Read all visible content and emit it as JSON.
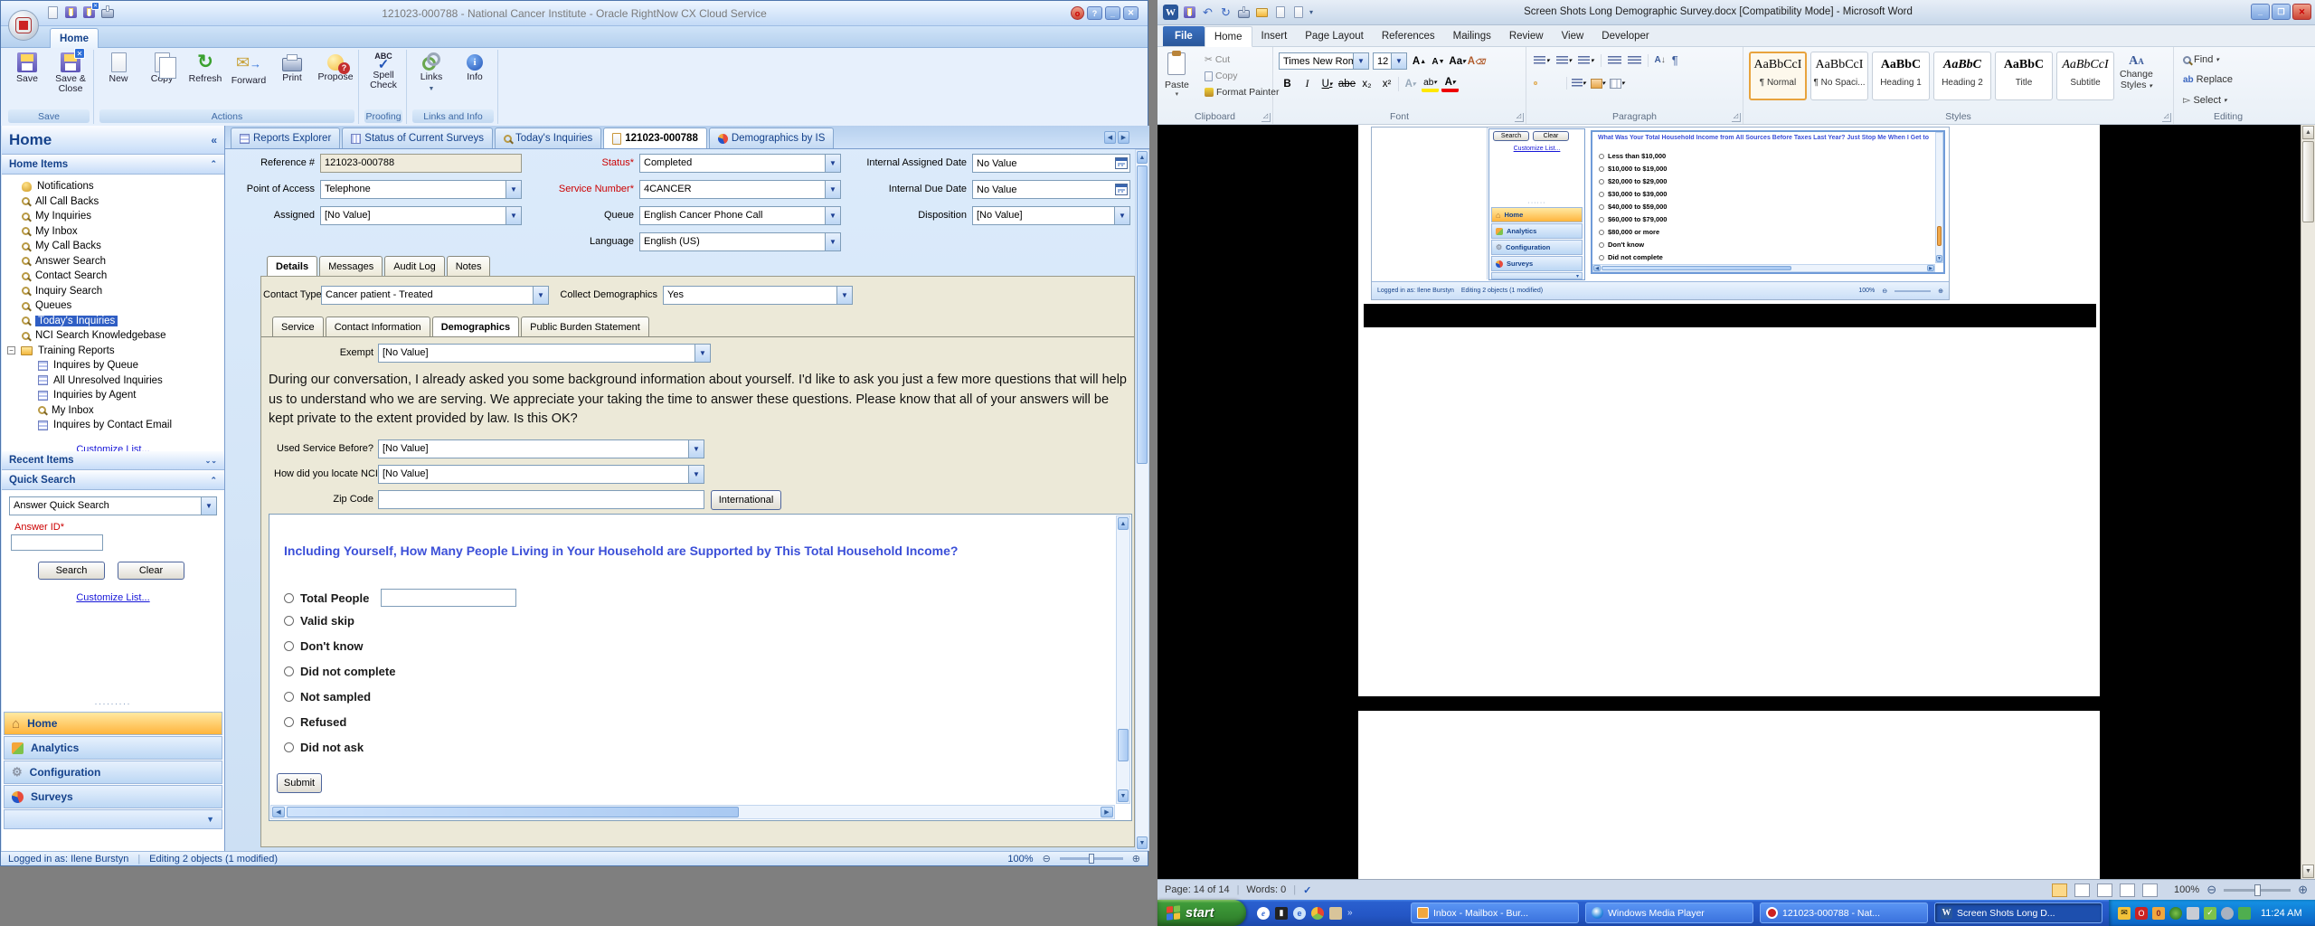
{
  "colors": {
    "rn_header_blue": "#15428b",
    "rn_selected_blue": "#2f5ec4",
    "highlight_orange": "#ffb43c",
    "survey_heading_blue": "#3b4fd8",
    "beige_panel": "#ece9d8",
    "word_file_tab_blue": "#2a579a",
    "xp_taskbar_blue": "#2456c5",
    "xp_start_green": "#3f9c3a",
    "required_red": "#cc0000"
  },
  "icons": {
    "oracle-orb": "red-ring-circle",
    "save-icon": "purple-floppy",
    "save-close-icon": "purple-floppy+blue-x",
    "new-icon": "blank-page",
    "copy-icon": "two-pages",
    "refresh-icon": "green-circular-arrows",
    "forward-icon": "envelope+blue-arrow",
    "print-icon": "printer",
    "propose-icon": "bulb+red-question",
    "spell-check-icon": "ABC+blue-check",
    "links-icon": "chain-links",
    "info-icon": "blue-info-circle",
    "magnifier": "gold-magnifying-glass",
    "bell": "gold-bell",
    "folder": "yellow-folder",
    "report": "blue-grid-report",
    "calendar": "blue-mini-calendar",
    "combo-arrow": "▼",
    "collapse-left": "«",
    "chevron-up": "^",
    "chevron-double-down": "v",
    "windows-flag": "four-color-flag",
    "home": "house",
    "analytics": "pie-chart",
    "configuration": "wrench",
    "surveys": "red-blue-pinwheel"
  },
  "rightnow": {
    "title": "121023-000788  - National Cancer Institute  - Oracle RightNow CX Cloud Service",
    "home_tab": "Home",
    "ribbon": {
      "groups": [
        {
          "label": "Save",
          "buttons": [
            {
              "label": "Save"
            },
            {
              "label": "Save & Close"
            }
          ]
        },
        {
          "label": "Actions",
          "buttons": [
            {
              "label": "New"
            },
            {
              "label": "Copy"
            },
            {
              "label": "Refresh"
            },
            {
              "label": "Forward"
            },
            {
              "label": "Print"
            },
            {
              "label": "Propose"
            }
          ]
        },
        {
          "label": "Proofing",
          "buttons": [
            {
              "label": "Spell Check"
            }
          ]
        },
        {
          "label": "Links and Info",
          "buttons": [
            {
              "label": "Links"
            },
            {
              "label": "Info"
            }
          ]
        }
      ]
    },
    "sidebar": {
      "header": "Home",
      "sections": {
        "home_items": "Home Items",
        "recent_items": "Recent Items",
        "quick_search": "Quick Search"
      },
      "items": [
        {
          "icon": "bell",
          "label": "Notifications"
        },
        {
          "icon": "magnifier",
          "label": "All Call Backs"
        },
        {
          "icon": "magnifier",
          "label": "My Inquiries"
        },
        {
          "icon": "magnifier",
          "label": "My Inbox"
        },
        {
          "icon": "magnifier",
          "label": "My Call Backs"
        },
        {
          "icon": "magnifier",
          "label": "Answer Search"
        },
        {
          "icon": "magnifier",
          "label": "Contact Search"
        },
        {
          "icon": "magnifier",
          "label": "Inquiry Search"
        },
        {
          "icon": "magnifier",
          "label": "Queues"
        },
        {
          "icon": "magnifier",
          "label": "Today's Inquiries",
          "selected": true
        },
        {
          "icon": "magnifier",
          "label": "NCI Search Knowledgebase"
        }
      ],
      "folder": {
        "icon": "folder",
        "label": "Training Reports",
        "children": [
          {
            "icon": "report",
            "label": "Inquires by Queue"
          },
          {
            "icon": "report",
            "label": "All Unresolved Inquiries"
          },
          {
            "icon": "report",
            "label": "Inquiries by Agent"
          },
          {
            "icon": "magnifier",
            "label": "My Inbox"
          },
          {
            "icon": "report",
            "label": "Inquires by Contact Email"
          }
        ]
      },
      "customize_link": "Customize List...",
      "quick_search": {
        "dropdown": "Answer Quick Search",
        "field_label": "Answer ID*",
        "field_value": "",
        "search_btn": "Search",
        "clear_btn": "Clear",
        "customize_link": "Customize List..."
      },
      "nav": [
        {
          "label": "Home",
          "active": true
        },
        {
          "label": "Analytics"
        },
        {
          "label": "Configuration"
        },
        {
          "label": "Surveys"
        }
      ]
    },
    "content_tabs": [
      {
        "label": "Reports Explorer"
      },
      {
        "label": "Status of Current Surveys"
      },
      {
        "label": "Today's Inquiries"
      },
      {
        "label": "121023-000788",
        "active": true
      },
      {
        "label": "Demographics by IS"
      }
    ],
    "form": {
      "reference": {
        "label": "Reference #",
        "value": "121023-000788"
      },
      "status": {
        "label": "Status*",
        "value": "Completed"
      },
      "internal_assigned": {
        "label": "Internal Assigned Date",
        "value": "No Value"
      },
      "point_of_access": {
        "label": "Point of Access",
        "value": "Telephone"
      },
      "service_number": {
        "label": "Service Number*",
        "value": "4CANCER"
      },
      "internal_due": {
        "label": "Internal Due Date",
        "value": "No Value"
      },
      "assigned": {
        "label": "Assigned",
        "value": "[No Value]"
      },
      "queue": {
        "label": "Queue",
        "value": "English Cancer Phone Call"
      },
      "disposition": {
        "label": "Disposition",
        "value": "[No Value]"
      },
      "language": {
        "label": "Language",
        "value": "English (US)"
      }
    },
    "detail_tabs": [
      {
        "label": "Details",
        "active": true
      },
      {
        "label": "Messages"
      },
      {
        "label": "Audit Log"
      },
      {
        "label": "Notes"
      }
    ],
    "details": {
      "contact_type": {
        "label": "Contact Type",
        "value": "Cancer patient - Treated"
      },
      "collect_demographics": {
        "label": "Collect Demographics",
        "value": "Yes"
      },
      "sub_tabs": [
        {
          "label": "Service"
        },
        {
          "label": "Contact Information"
        },
        {
          "label": "Demographics",
          "active": true
        },
        {
          "label": "Public Burden Statement"
        }
      ],
      "exempt": {
        "label": "Exempt",
        "value": "[No Value]"
      },
      "intro": "During our conversation, I already asked you some background information about yourself. I'd like to ask you just a few more questions that will help us to understand who we are serving. We appreciate your taking the time to answer these questions. Please know that all of your answers will be kept private to the extent provided by law. Is this OK?",
      "used_service": {
        "label": "Used Service Before?",
        "value": "[No Value]"
      },
      "locate_nci": {
        "label": "How did you locate NCI?",
        "value": "[No Value]"
      },
      "zip": {
        "label": "Zip Code",
        "value": ""
      },
      "international_btn": "International"
    },
    "survey": {
      "question": "Including Yourself, How Many People Living in Your Household are Supported by This Total Household Income?",
      "options": [
        {
          "label": "Total People",
          "has_input": true,
          "input_value": ""
        },
        {
          "label": "Valid skip"
        },
        {
          "label": "Don't know"
        },
        {
          "label": "Did not complete"
        },
        {
          "label": "Not sampled"
        },
        {
          "label": "Refused"
        },
        {
          "label": "Did not ask"
        }
      ],
      "submit": "Submit"
    },
    "status_bar": {
      "logged_in": "Logged in as: Ilene Burstyn",
      "editing": "Editing 2 objects (1 modified)",
      "zoom": "100%"
    }
  },
  "word": {
    "title": "Screen Shots Long Demographic Survey.docx [Compatibility Mode] - Microsoft Word",
    "tabs": [
      {
        "label": "File",
        "file": true
      },
      {
        "label": "Home",
        "active": true
      },
      {
        "label": "Insert"
      },
      {
        "label": "Page Layout"
      },
      {
        "label": "References"
      },
      {
        "label": "Mailings"
      },
      {
        "label": "Review"
      },
      {
        "label": "View"
      },
      {
        "label": "Developer"
      }
    ],
    "ribbon": {
      "clipboard": {
        "label": "Clipboard",
        "paste": "Paste",
        "cut": "Cut",
        "copy": "Copy",
        "format_painter": "Format Painter"
      },
      "font": {
        "label": "Font",
        "family": "Times New Rom",
        "size": "12"
      },
      "paragraph": {
        "label": "Paragraph"
      },
      "styles": {
        "label": "Styles",
        "items": [
          {
            "preview": "AaBbCcI",
            "name": "¶ Normal",
            "selected": true
          },
          {
            "preview": "AaBbCcI",
            "name": "¶ No Spaci..."
          },
          {
            "preview": "AaBbC",
            "name": "Heading 1"
          },
          {
            "preview": "AaBbC",
            "name": "Heading 2"
          },
          {
            "preview": "AaBbC",
            "name": "Title"
          },
          {
            "preview": "AaBbCcI",
            "name": "Subtitle"
          }
        ],
        "change_styles_1": "Change",
        "change_styles_2": "Styles"
      },
      "editing": {
        "label": "Editing",
        "find": "Find",
        "replace": "Replace",
        "select": "Select"
      }
    },
    "document": {
      "mini_panel": {
        "search_btn": "Search",
        "clear_btn": "Clear",
        "customize_link": "Customize List...",
        "nav": [
          {
            "label": "Home",
            "active": true
          },
          {
            "label": "Analytics"
          },
          {
            "label": "Configuration"
          },
          {
            "label": "Surveys"
          }
        ]
      },
      "income_survey": {
        "question": "What Was Your Total Household Income from All Sources Before Taxes Last Year? Just Stop Me When I Get to the Right Ca",
        "options": [
          "Less than $10,000",
          "$10,000 to $19,000",
          "$20,000 to $29,000",
          "$30,000 to $39,000",
          "$40,000 to $59,000",
          "$60,000 to $79,000",
          "$80,000 or more",
          "Don't know",
          "Did not complete"
        ]
      },
      "status_bar": {
        "logged_in": "Logged in as: Ilene Burstyn",
        "editing": "Editing 2 objects (1 modified)",
        "zoom": "100%"
      }
    },
    "status_bar": {
      "page": "Page: 14 of 14",
      "words": "Words: 0",
      "zoom": "100%"
    }
  },
  "taskbar": {
    "start": "start",
    "tasks": [
      {
        "label": "Inbox - Mailbox - Bur..."
      },
      {
        "label": "Windows Media Player"
      },
      {
        "label": "121023-000788 - Nat..."
      },
      {
        "label": "Screen Shots Long D...",
        "active": true
      }
    ],
    "clock": "11:24 AM"
  }
}
